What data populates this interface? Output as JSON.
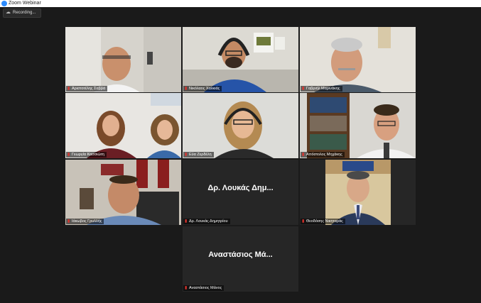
{
  "window": {
    "title": "Zoom Webinar"
  },
  "recording": {
    "label": "Recording..."
  },
  "colors": {
    "active_speaker": "#e6e35a",
    "mic_muted": "#e0322c",
    "background": "#1a1a1a"
  },
  "participants": [
    {
      "name": "Αριστοτέλης Σαββά",
      "muted": true
    },
    {
      "name": "Νικόλαος Χαλκιάς",
      "muted": true
    },
    {
      "name": "Γαβριήλ Μαρινάκης",
      "muted": true
    },
    {
      "name": "Γεωργία Κασσιώτη",
      "muted": true,
      "active": true
    },
    {
      "name": "Εύα Ζερδέλη",
      "muted": true
    },
    {
      "name": "Απόστολος Μηχάκης",
      "muted": true
    },
    {
      "name": "Ιάκωβος Γρυλλής",
      "muted": true
    },
    {
      "name": "Δρ. Λουκάς Δημητρίου",
      "display": "Δρ. Λουκάς Δημ...",
      "muted": true,
      "video_off": true
    },
    {
      "name": "Θεοδόσης Νικηταράς",
      "muted": true
    },
    {
      "name": "Αναστάσιος Μάνος",
      "display": "Αναστάσιος Μά...",
      "muted": true,
      "video_off": true
    }
  ]
}
